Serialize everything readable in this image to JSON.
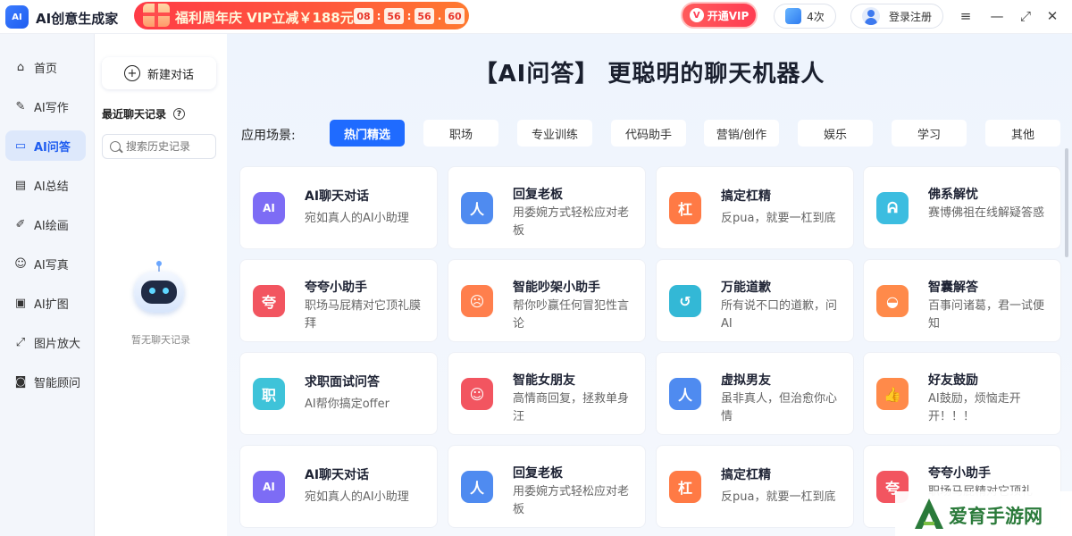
{
  "app": {
    "logo": "AI",
    "title": "AI创意生成家"
  },
  "promo": {
    "text": "福利周年庆 VIP立减￥188元",
    "countdown": [
      "08",
      "56",
      "56",
      "60"
    ]
  },
  "header": {
    "vip_label": "开通VIP",
    "vip_icon": "V",
    "count_label": "4次",
    "login_label": "登录注册"
  },
  "nav": {
    "items": [
      {
        "label": "首页",
        "icon": "home-icon"
      },
      {
        "label": "AI写作",
        "icon": "pen-icon"
      },
      {
        "label": "AI问答",
        "icon": "chat-icon",
        "active": true
      },
      {
        "label": "AI总结",
        "icon": "document-icon"
      },
      {
        "label": "AI绘画",
        "icon": "brush-icon"
      },
      {
        "label": "AI写真",
        "icon": "portrait-icon"
      },
      {
        "label": "AI扩图",
        "icon": "expand-image-icon"
      },
      {
        "label": "图片放大",
        "icon": "zoom-image-icon"
      },
      {
        "label": "智能顾问",
        "icon": "robot-icon"
      }
    ]
  },
  "history": {
    "new_chat": "新建对话",
    "recent_title": "最近聊天记录",
    "search_placeholder": "搜索历史记录",
    "empty_text": "暂无聊天记录"
  },
  "main": {
    "headline": "【AI问答】 更聪明的聊天机器人",
    "scene_label": "应用场景:",
    "categories": [
      "热门精选",
      "职场",
      "专业训练",
      "代码助手",
      "营销/创作",
      "娱乐",
      "学习",
      "其他"
    ],
    "active_category": "热门精选",
    "cards": [
      {
        "title": "AI聊天对话",
        "desc": "宛如真人的AI小助理",
        "icon": "ai-chat-icon",
        "glyph": "AI",
        "color": "#7d6cf5"
      },
      {
        "title": "回复老板",
        "desc": "用委婉方式轻松应对老板",
        "icon": "boss-icon",
        "glyph": "人",
        "color": "#4f8bf0"
      },
      {
        "title": "搞定杠精",
        "desc": "反pua，就要一杠到底",
        "icon": "bar-icon",
        "glyph": "杠",
        "color": "#ff7a45"
      },
      {
        "title": "佛系解忧",
        "desc": "赛博佛祖在线解疑答惑",
        "icon": "buddha-icon",
        "glyph": "ᕱ",
        "color": "#3cbde0"
      },
      {
        "title": "夸夸小助手",
        "desc": "职场马屁精对它顶礼膜拜",
        "icon": "praise-icon",
        "glyph": "夸",
        "color": "#f25560"
      },
      {
        "title": "智能吵架小助手",
        "desc": "帮你吵赢任何冒犯性言论",
        "icon": "angry-face-icon",
        "glyph": "☹",
        "color": "#ff7f4d"
      },
      {
        "title": "万能道歉",
        "desc": "所有说不口的道歉，问AI",
        "icon": "apology-icon",
        "glyph": "↺",
        "color": "#33b8d6"
      },
      {
        "title": "智囊解答",
        "desc": "百事问诸葛，君一试便知",
        "icon": "advisor-icon",
        "glyph": "◒",
        "color": "#ff8a4a"
      },
      {
        "title": "求职面试问答",
        "desc": "AI帮你搞定offer",
        "icon": "interview-icon",
        "glyph": "职",
        "color": "#3ec3d9"
      },
      {
        "title": "智能女朋友",
        "desc": "高情商回复，拯救单身汪",
        "icon": "girlfriend-icon",
        "glyph": "☺",
        "color": "#f25560"
      },
      {
        "title": "虚拟男友",
        "desc": "虽非真人，但治愈你心情",
        "icon": "boyfriend-icon",
        "glyph": "人",
        "color": "#4f8bf0"
      },
      {
        "title": "好友鼓励",
        "desc": "AI鼓励，烦恼走开开！！！",
        "icon": "thumbs-up-icon",
        "glyph": "👍",
        "color": "#ff8a4a"
      },
      {
        "title": "AI聊天对话",
        "desc": "宛如真人的AI小助理",
        "icon": "ai-chat-icon",
        "glyph": "AI",
        "color": "#7d6cf5"
      },
      {
        "title": "回复老板",
        "desc": "用委婉方式轻松应对老板",
        "icon": "boss-icon",
        "glyph": "人",
        "color": "#4f8bf0"
      },
      {
        "title": "搞定杠精",
        "desc": "反pua，就要一杠到底",
        "icon": "bar-icon",
        "glyph": "杠",
        "color": "#ff7a45"
      },
      {
        "title": "夸夸小助手",
        "desc": "职场马屁精对它顶礼",
        "icon": "praise-icon",
        "glyph": "夸",
        "color": "#f25560"
      }
    ]
  },
  "watermark": {
    "text": "爱育手游网"
  }
}
